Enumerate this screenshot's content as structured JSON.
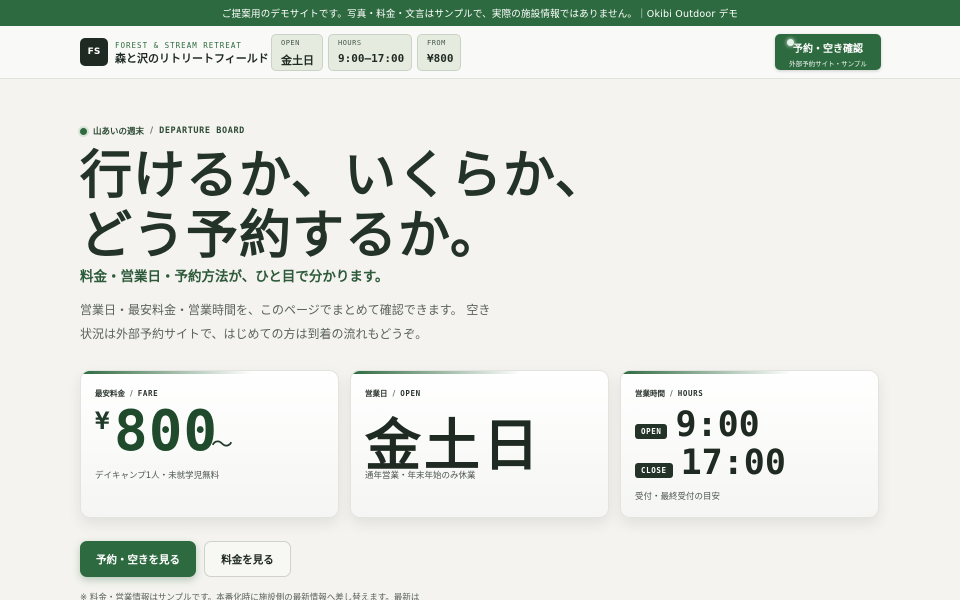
{
  "banner": {
    "text": "ご提案用のデモサイトです。写真・料金・文言はサンプルで、実際の施設情報ではありません。｜Okibi Outdoor デモ"
  },
  "header": {
    "logo_text": "FS",
    "brand_sub": "FOREST & STREAM RETREAT",
    "brand_main": "森と沢のリトリートフィールド",
    "chips": [
      {
        "label": "OPEN",
        "value": "金土日"
      },
      {
        "label": "HOURS",
        "value": "9:00–17:00"
      },
      {
        "label": "FROM",
        "value": "¥800"
      }
    ],
    "reserve": {
      "main": "予約・空き確認",
      "sub": "外部予約サイト・サンプル"
    }
  },
  "hero": {
    "eyebrow_jp": "山あいの週末",
    "eyebrow_sep": "/",
    "eyebrow_en": "DEPARTURE BOARD",
    "headline_line1": "行けるか、いくらか、",
    "headline_line2": "どう予約するか。",
    "tagline": "料金・営業日・予約方法が、ひと目で分かります。",
    "intro": "営業日・最安料金・営業時間を、このページでまとめて確認できます。 空き状況は外部予約サイトで、はじめての方は到着の流れもどうぞ。"
  },
  "cards": {
    "fare": {
      "label_jp": "最安料金",
      "label_en": "FARE",
      "yen": "¥",
      "value": "800",
      "suffix": "〜",
      "note": "デイキャンプ1人・未就学児無料"
    },
    "open": {
      "label_jp": "営業日",
      "label_en": "OPEN",
      "value": "金土日",
      "note": "通年営業・年末年始のみ休業"
    },
    "hours": {
      "label_jp": "営業時間",
      "label_en": "HOURS",
      "open_badge": "OPEN",
      "open_time": "9:00",
      "close_badge": "CLOSE",
      "close_time": "17:00",
      "note": "受付・最終受付の目安"
    }
  },
  "cta": {
    "primary": "予約・空きを見る",
    "secondary": "料金を見る"
  },
  "footnote": "※ 料金・営業情報はサンプルです。本番化時に施設側の最新情報へ差し替えます。最新は",
  "colors": {
    "accent": "#2d6a3f",
    "dark": "#1f2a22",
    "background": "#f4f3ef"
  }
}
